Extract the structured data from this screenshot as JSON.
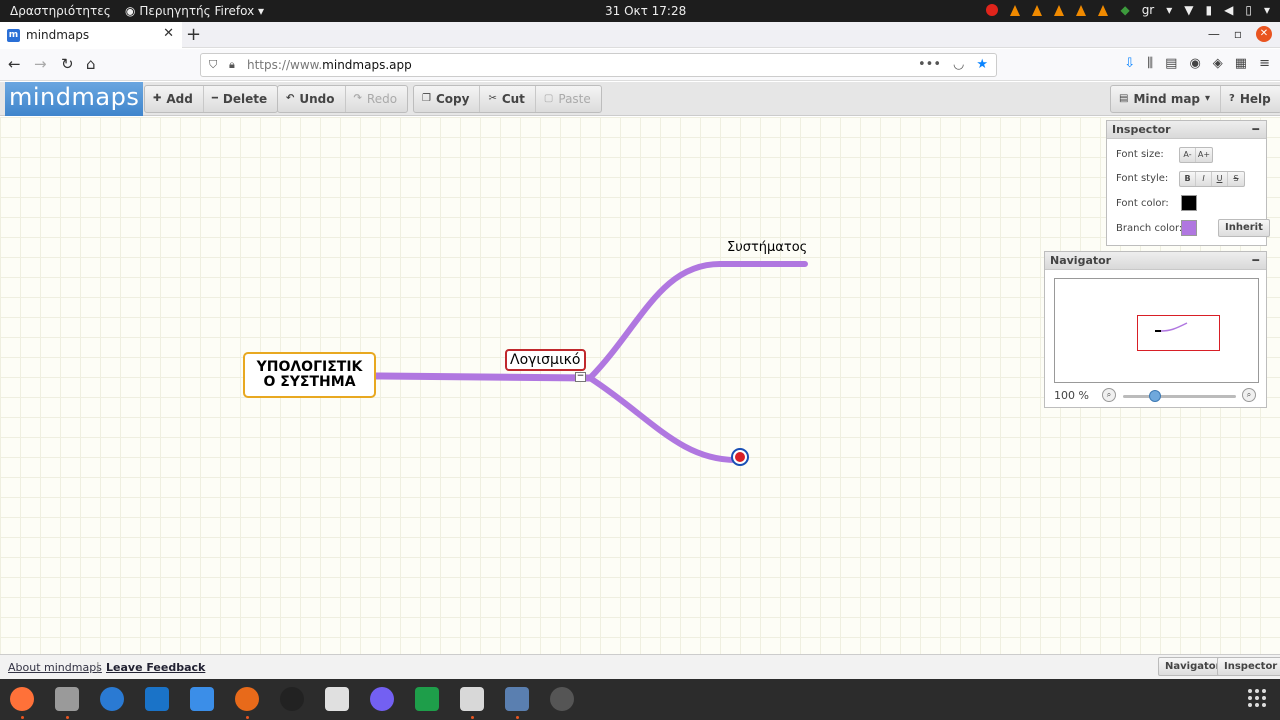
{
  "system_bar": {
    "activities": "Δραστηριότητες",
    "app_menu": "Περιηγητής Firefox",
    "clock": "31 Οκτ  17:28",
    "keyboard_layout": "gr"
  },
  "browser": {
    "tab_title": "mindmaps",
    "favicon_letter": "m",
    "url_prefix": "https://www.",
    "url_domain": "mindmaps.app"
  },
  "app": {
    "logo": "mindmaps",
    "toolbar": {
      "add": "Add",
      "delete": "Delete",
      "undo": "Undo",
      "redo": "Redo",
      "copy": "Copy",
      "cut": "Cut",
      "paste": "Paste",
      "mindmap_menu": "Mind map",
      "help": "Help"
    },
    "map": {
      "root_line1": "ΥΠΟΛΟΓΙΣΤΙΚ",
      "root_line2": "Ο ΣΥΣΤΗΜΑ",
      "child": "Λογισμικό",
      "leaf": "Συστήματος",
      "branch_color": "#b077e0",
      "root_border_color": "#e8a820",
      "selected_border_color": "#c0282c"
    },
    "inspector": {
      "title": "Inspector",
      "font_size_label": "Font size:",
      "font_size_buttons": [
        "A-",
        "A+"
      ],
      "font_style_label": "Font style:",
      "font_style_buttons": [
        "B",
        "I",
        "U",
        "S"
      ],
      "font_color_label": "Font color:",
      "font_color": "#000000",
      "branch_color_label": "Branch color:",
      "branch_color": "#b077e0",
      "inherit": "Inherit"
    },
    "navigator": {
      "title": "Navigator",
      "zoom": "100 %",
      "zoom_level": 0.3
    },
    "footer": {
      "about": "About mindmaps",
      "separator": "|",
      "feedback": "Leave Feedback",
      "navigator_btn": "Navigator",
      "inspector_btn": "Inspector"
    }
  }
}
